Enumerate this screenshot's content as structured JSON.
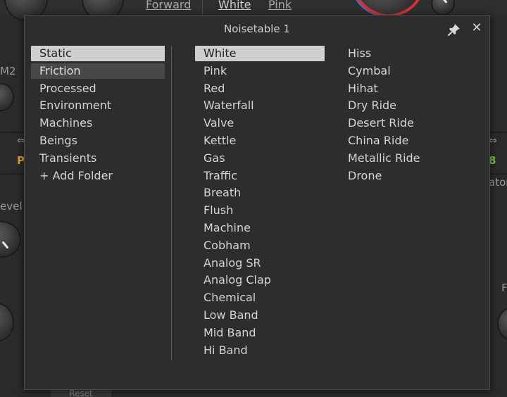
{
  "background": {
    "links": [
      "Forward",
      "White",
      "Pink"
    ],
    "labels": [
      "M2",
      "evel",
      "P",
      "8",
      "ator",
      "F",
      "Reset"
    ]
  },
  "dialog": {
    "title": "Noisetable 1",
    "pin_icon": "pin-icon",
    "close_icon": "close-icon",
    "close_glyph": "✕",
    "folders": [
      {
        "label": "Static",
        "state": "selected"
      },
      {
        "label": "Friction",
        "state": "hover"
      },
      {
        "label": "Processed",
        "state": "normal"
      },
      {
        "label": "Environment",
        "state": "normal"
      },
      {
        "label": "Machines",
        "state": "normal"
      },
      {
        "label": "Beings",
        "state": "normal"
      },
      {
        "label": "Transients",
        "state": "normal"
      },
      {
        "label": "+ Add Folder",
        "state": "normal"
      }
    ],
    "tables_col1": [
      {
        "label": "White",
        "state": "selected"
      },
      {
        "label": "Pink",
        "state": "normal"
      },
      {
        "label": "Red",
        "state": "normal"
      },
      {
        "label": "Waterfall",
        "state": "normal"
      },
      {
        "label": "Valve",
        "state": "normal"
      },
      {
        "label": "Kettle",
        "state": "normal"
      },
      {
        "label": "Gas",
        "state": "normal"
      },
      {
        "label": "Traffic",
        "state": "normal"
      },
      {
        "label": "Breath",
        "state": "normal"
      },
      {
        "label": "Flush",
        "state": "normal"
      },
      {
        "label": "Machine",
        "state": "normal"
      },
      {
        "label": "Cobham",
        "state": "normal"
      },
      {
        "label": "Analog SR",
        "state": "normal"
      },
      {
        "label": "Analog Clap",
        "state": "normal"
      },
      {
        "label": "Chemical",
        "state": "normal"
      },
      {
        "label": "Low Band",
        "state": "normal"
      },
      {
        "label": "Mid Band",
        "state": "normal"
      },
      {
        "label": "Hi Band",
        "state": "normal"
      }
    ],
    "tables_col2": [
      {
        "label": "Hiss",
        "state": "normal"
      },
      {
        "label": "Cymbal",
        "state": "normal"
      },
      {
        "label": "Hihat",
        "state": "normal"
      },
      {
        "label": "Dry Ride",
        "state": "normal"
      },
      {
        "label": "Desert Ride",
        "state": "normal"
      },
      {
        "label": "China Ride",
        "state": "normal"
      },
      {
        "label": "Metallic Ride",
        "state": "normal"
      },
      {
        "label": "Drone",
        "state": "normal"
      }
    ]
  },
  "colors": {
    "selected_bg": "#cfcfcf",
    "hover_bg": "#484848",
    "dialog_bg": "#2d2d2d",
    "accent_orange": "#e0a030",
    "accent_green": "#7ac943",
    "accent_red": "#d93030",
    "accent_blue": "#3a6fd0"
  }
}
